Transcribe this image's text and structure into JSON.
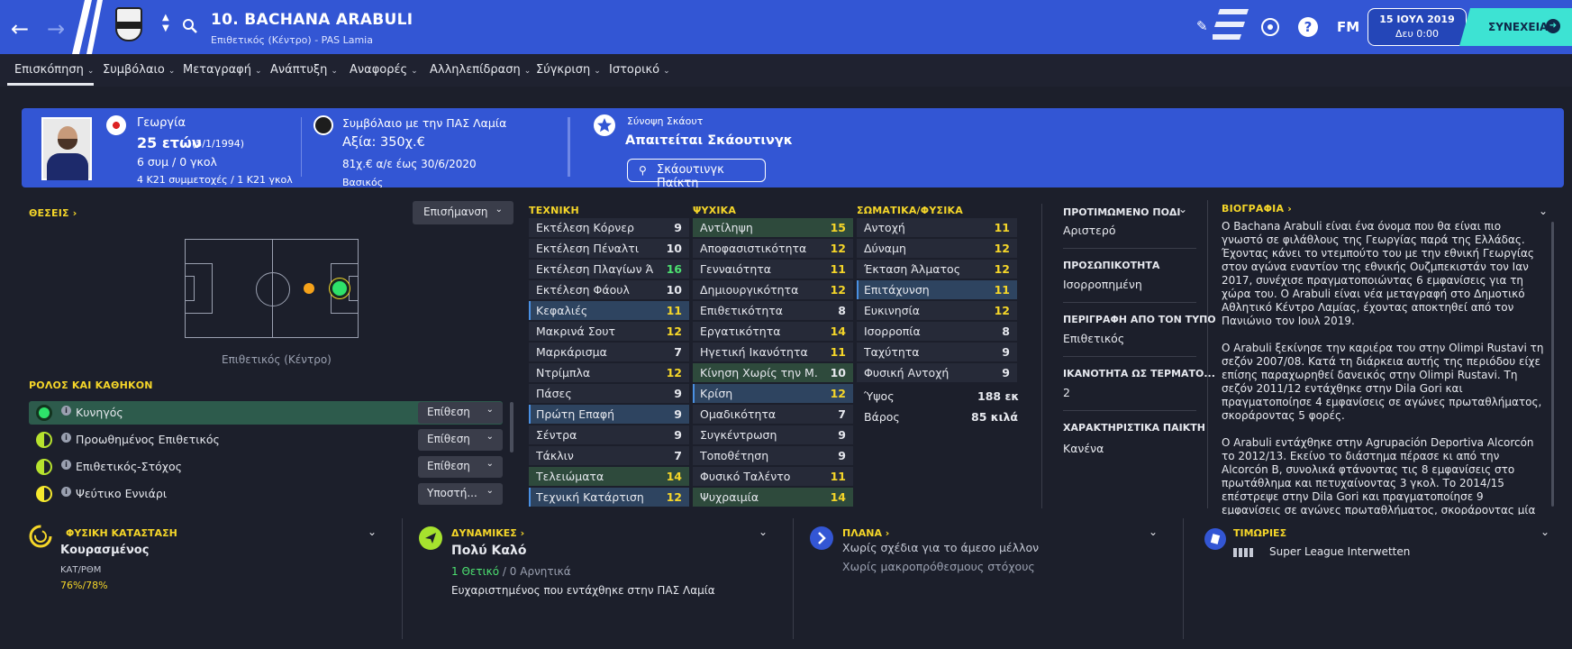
{
  "header": {
    "player_title": "10. BACHANA ARABULI",
    "player_subtitle": "Επιθετικός (Κέντρο) - PAS Lamia",
    "date": "15 ΙΟΥΛ 2019",
    "day_time": "Δευ 0:00",
    "continue_label": "ΣΥΝΕΧΕΙΑ",
    "fm_label": "FM"
  },
  "menu": [
    "Επισκόπηση",
    "Συμβόλαιο",
    "Μεταγραφή",
    "Ανάπτυξη",
    "Αναφορές",
    "Αλληλεπίδραση",
    "Σύγκριση",
    "Ιστορικό"
  ],
  "card": {
    "nation": "Γεωργία",
    "age": "25 ετών",
    "dob": "(5/1/1994)",
    "caps": "6 συμ / 0 γκολ",
    "u21": "4 Κ21 συμμετοχές / 1 Κ21 γκολ",
    "contract_label": "Συμβόλαιο με την ΠΑΣ Λαμία",
    "value": "Αξία: 350χ.€",
    "wage": "81χ.€ α/ε έως 30/6/2020",
    "role_cut": "Βασικός",
    "scout_summary_label": "Σύνοψη Σκάουτ",
    "scout_required": "Απαιτείται Σκάουτινγκ",
    "scout_button": "Σκάουτινγκ Παίκτη"
  },
  "positions": {
    "title": "ΘΕΣΕΙΣ",
    "highlight_dropdown": "Επισήμανση",
    "position_label": "Επιθετικός (Κέντρο)"
  },
  "roles": {
    "title": "ΡΟΛΟΣ ΚΑΙ ΚΑΘΗΚΟΝ",
    "items": [
      {
        "label": "Κυνηγός",
        "duty": "Επίθεση"
      },
      {
        "label": "Προωθημένος Επιθετικός",
        "duty": "Επίθεση"
      },
      {
        "label": "Επιθετικός-Στόχος",
        "duty": "Επίθεση"
      },
      {
        "label": "Ψεύτικο Εννιάρι",
        "duty": "Υποστή..."
      }
    ]
  },
  "technical": {
    "title": "ΤΕΧΝΙΚΗ",
    "rows": [
      {
        "name": "Εκτέλεση Κόρνερ",
        "value": "9"
      },
      {
        "name": "Εκτέλεση Πέναλτι",
        "value": "10"
      },
      {
        "name": "Εκτέλεση Πλαγίων Ά...",
        "value": "16"
      },
      {
        "name": "Εκτέλεση Φάουλ",
        "value": "10"
      },
      {
        "name": "Κεφαλιές",
        "value": "11"
      },
      {
        "name": "Μακρινά Σουτ",
        "value": "12"
      },
      {
        "name": "Μαρκάρισμα",
        "value": "7"
      },
      {
        "name": "Ντρίμπλα",
        "value": "12"
      },
      {
        "name": "Πάσες",
        "value": "9"
      },
      {
        "name": "Πρώτη Επαφή",
        "value": "9"
      },
      {
        "name": "Σέντρα",
        "value": "9"
      },
      {
        "name": "Τάκλιν",
        "value": "7"
      },
      {
        "name": "Τελειώματα",
        "value": "14"
      },
      {
        "name": "Τεχνική Κατάρτιση",
        "value": "12"
      }
    ]
  },
  "mental": {
    "title": "ΨΥΧΙΚΑ",
    "rows": [
      {
        "name": "Αντίληψη",
        "value": "15"
      },
      {
        "name": "Αποφασιστικότητα",
        "value": "12"
      },
      {
        "name": "Γενναιότητα",
        "value": "11"
      },
      {
        "name": "Δημιουργικότητα",
        "value": "12"
      },
      {
        "name": "Επιθετικότητα",
        "value": "8"
      },
      {
        "name": "Εργατικότητα",
        "value": "14"
      },
      {
        "name": "Ηγετική Ικανότητα",
        "value": "11"
      },
      {
        "name": "Κίνηση Χωρίς την Μ...",
        "value": "10"
      },
      {
        "name": "Κρίση",
        "value": "12"
      },
      {
        "name": "Ομαδικότητα",
        "value": "7"
      },
      {
        "name": "Συγκέντρωση",
        "value": "9"
      },
      {
        "name": "Τοποθέτηση",
        "value": "9"
      },
      {
        "name": "Φυσικό Ταλέντο",
        "value": "11"
      },
      {
        "name": "Ψυχραιμία",
        "value": "14"
      }
    ]
  },
  "physical": {
    "title": "ΣΩΜΑΤΙΚΑ/ΦΥΣΙΚΑ",
    "rows": [
      {
        "name": "Αντοχή",
        "value": "11"
      },
      {
        "name": "Δύναμη",
        "value": "12"
      },
      {
        "name": "Έκταση Άλματος",
        "value": "12"
      },
      {
        "name": "Επιτάχυνση",
        "value": "11"
      },
      {
        "name": "Ευκινησία",
        "value": "12"
      },
      {
        "name": "Ισορροπία",
        "value": "8"
      },
      {
        "name": "Ταχύτητα",
        "value": "9"
      },
      {
        "name": "Φυσική Αντοχή",
        "value": "9"
      }
    ],
    "height_label": "Ύψος",
    "height_value": "188 εκ",
    "weight_label": "Βάρος",
    "weight_value": "85 κιλά"
  },
  "details": {
    "preferred_foot_label": "ΠΡΟΤΙΜΩΜΕΝΟ ΠΟΔΙ",
    "preferred_foot": "Αριστερό",
    "personality_label": "ΠΡΟΣΩΠΙΚΟΤΗΤΑ",
    "personality": "Ισορροπημένη",
    "type_label": "ΠΕΡΙΓΡΑΦΗ ΑΠΟ ΤΟΝ ΤΥΠΟ",
    "type": "Επιθετικός",
    "gk_label": "ΙΚΑΝΟΤΗΤΑ ΩΣ ΤΕΡΜΑΤΟ...",
    "gk": "2",
    "traits_label": "ΧΑΡΑΚΤΗΡΙΣΤΙΚΑ ΠΑΙΚΤΗ",
    "traits": "Κανένα"
  },
  "bio": {
    "title": "ΒΙΟΓΡΑΦΙΑ",
    "p1": "Ο Bachana Arabuli είναι ένα όνομα που θα είναι πιο γνωστό σε φιλάθλους της Γεωργίας παρά της Ελλάδας. Έχοντας κάνει το ντεμπούτο του με την εθνική Γεωργίας στον αγώνα εναντίον της εθνικής Ουζμπεκιστάν τον Ιαν 2017, συνέχισε πραγματοποιώντας 6 εμφανίσεις για τη χώρα του. Ο Arabuli είναι νέα μεταγραφή στο Δημοτικό Αθλητικό Κέντρο Λαμίας, έχοντας αποκτηθεί από τον Πανιώνιο τον Ιουλ 2019.",
    "p2": "Ο Arabuli ξεκίνησε την καριέρα του στην Olimpi Rustavi τη σεζόν 2007/08. Κατά τη διάρκεια αυτής της περιόδου είχε επίσης παραχωρηθεί δανεικός στην Olimpi Rustavi. Τη σεζόν 2011/12 εντάχθηκε στην Dila Gori και πραγματοποίησε 4 εμφανίσεις σε αγώνες πρωταθλήματος, σκοράροντας 5 φορές.",
    "p3": "Ο Arabuli εντάχθηκε στην Agrupación Deportiva Alcorcón το 2012/13. Εκείνο το διάστημα πέρασε κι από την Alcorcón B, συνολικά φτάνοντας τις 8 εμφανίσεις στο πρωτάθλημα και πετυχαίνοντας 3 γκολ. Το 2014/15 επέστρεψε στην Dila Gori και πραγματοποίησε 9 εμφανίσεις σε αγώνες πρωταθλήματος, σκοράροντας μία φορά."
  },
  "bottom": {
    "condition_title": "ΦΥΣΙΚΗ ΚΑΤΑΣΤΑΣΗ",
    "condition": "Κουρασμένος",
    "cond_label": "ΚΑΤ/ΡΘΜ",
    "cond_value": "76%/78%",
    "dynamics_title": "ΔΥΝΑΜΙΚΕΣ",
    "dynamics": "Πολύ Καλό",
    "positive": "1 Θετικό",
    "sep": "/",
    "negative": "0 Αρνητικά",
    "dynamics_note": "Ευχαριστημένος που εντάχθηκε στην ΠΑΣ Λαμία",
    "plans_title": "ΠΛΑΝΑ",
    "plan_short": "Χωρίς σχέδια για το άμεσο μέλλον",
    "plan_long": "Χωρίς μακροπρόθεσμους στόχους",
    "bans_title": "ΤΙΜΩΡΙΕΣ",
    "league": "Super League Interwetten"
  }
}
